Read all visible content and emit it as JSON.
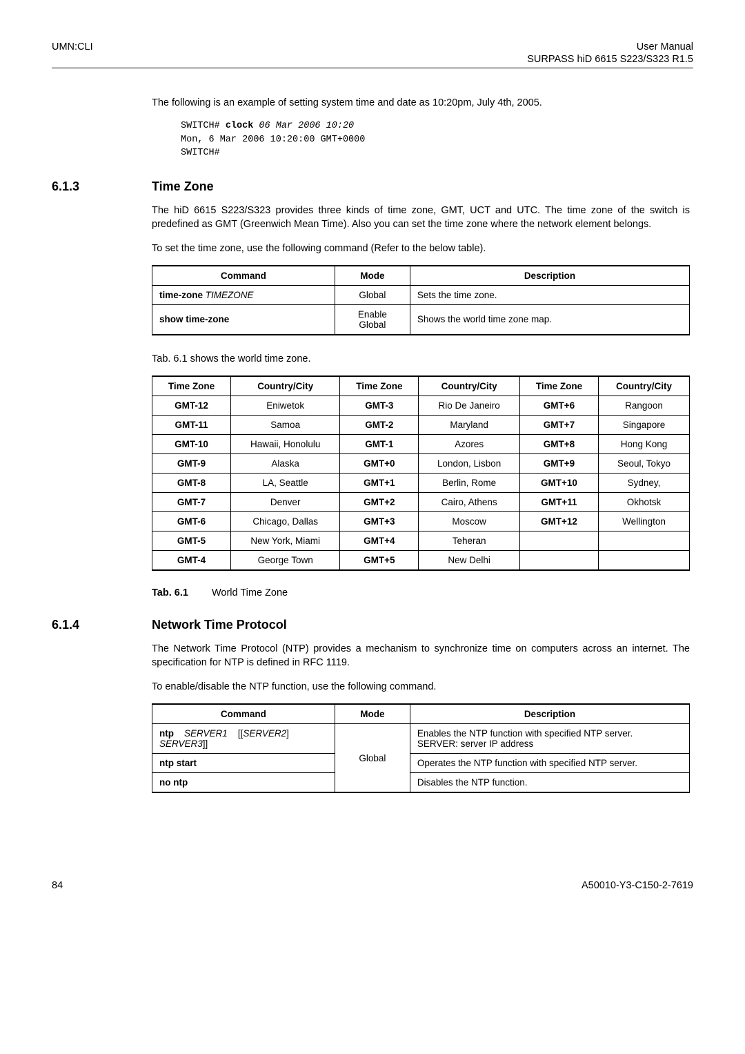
{
  "header": {
    "left": "UMN:CLI",
    "right_top": "User Manual",
    "right_sub": "SURPASS hiD 6615 S223/S323 R1.5"
  },
  "intro_para": "The following is an example of setting system time and date as 10:20pm, July 4th, 2005.",
  "code": {
    "line1_pre": "SWITCH# ",
    "line1_bold": "clock ",
    "line1_ital": "06 Mar 2006 10:20",
    "line2": "Mon, 6 Mar 2006 10:20:00 GMT+0000",
    "line3": "SWITCH#"
  },
  "sec1": {
    "num": "6.1.3",
    "title": "Time Zone",
    "para1": "The hiD 6615 S223/S323 provides three kinds of time zone, GMT, UCT and UTC. The time zone of the switch is predefined as GMT (Greenwich Mean Time). Also you can set the time zone where the network element belongs.",
    "para2": "To set the time zone, use the following command (Refer to the below table).",
    "table1": {
      "head": [
        "Command",
        "Mode",
        "Description"
      ],
      "rows": [
        {
          "command_b": "time-zone ",
          "command_i": "TIMEZONE",
          "mode": "Global",
          "desc": "Sets the time zone."
        },
        {
          "command_b": "show time-zone",
          "command_i": "",
          "mode1": "Enable",
          "mode2": "Global",
          "desc": "Shows the world time zone map."
        }
      ]
    },
    "para3": "Tab. 6.1 shows the world time zone.",
    "table2": {
      "head": [
        "Time Zone",
        "Country/City",
        "Time Zone",
        "Country/City",
        "Time Zone",
        "Country/City"
      ],
      "rows": [
        [
          "GMT-12",
          "Eniwetok",
          "GMT-3",
          "Rio De Janeiro",
          "GMT+6",
          "Rangoon"
        ],
        [
          "GMT-11",
          "Samoa",
          "GMT-2",
          "Maryland",
          "GMT+7",
          "Singapore"
        ],
        [
          "GMT-10",
          "Hawaii, Honolulu",
          "GMT-1",
          "Azores",
          "GMT+8",
          "Hong Kong"
        ],
        [
          "GMT-9",
          "Alaska",
          "GMT+0",
          "London, Lisbon",
          "GMT+9",
          "Seoul, Tokyo"
        ],
        [
          "GMT-8",
          "LA, Seattle",
          "GMT+1",
          "Berlin, Rome",
          "GMT+10",
          "Sydney,"
        ],
        [
          "GMT-7",
          "Denver",
          "GMT+2",
          "Cairo, Athens",
          "GMT+11",
          "Okhotsk"
        ],
        [
          "GMT-6",
          "Chicago, Dallas",
          "GMT+3",
          "Moscow",
          "GMT+12",
          "Wellington"
        ],
        [
          "GMT-5",
          "New York, Miami",
          "GMT+4",
          "Teheran",
          "",
          ""
        ],
        [
          "GMT-4",
          "George Town",
          "GMT+5",
          "New Delhi",
          "",
          ""
        ]
      ]
    },
    "caption": {
      "label": "Tab. 6.1",
      "text": "World Time Zone"
    }
  },
  "sec2": {
    "num": "6.1.4",
    "title": "Network Time Protocol",
    "para1": "The Network Time Protocol (NTP) provides a mechanism to synchronize time on computers across an internet. The specification for NTP is defined in RFC 1119.",
    "para2": "To enable/disable the NTP function, use the following command.",
    "table": {
      "head": [
        "Command",
        "Mode",
        "Description"
      ],
      "rows": [
        {
          "command_parts": [
            "ntp",
            "SERVER1",
            "[[",
            "SERVER2",
            "]",
            "SERVER3",
            "]]"
          ],
          "mode": "Global",
          "desc": "Enables the NTP function with specified NTP server.\nSERVER: server IP address"
        },
        {
          "command_b": "ntp start",
          "desc": "Operates the NTP function with specified NTP server."
        },
        {
          "command_b": "no ntp",
          "desc": "Disables the NTP function."
        }
      ]
    }
  },
  "footer": {
    "left": "84",
    "right": "A50010-Y3-C150-2-7619"
  }
}
